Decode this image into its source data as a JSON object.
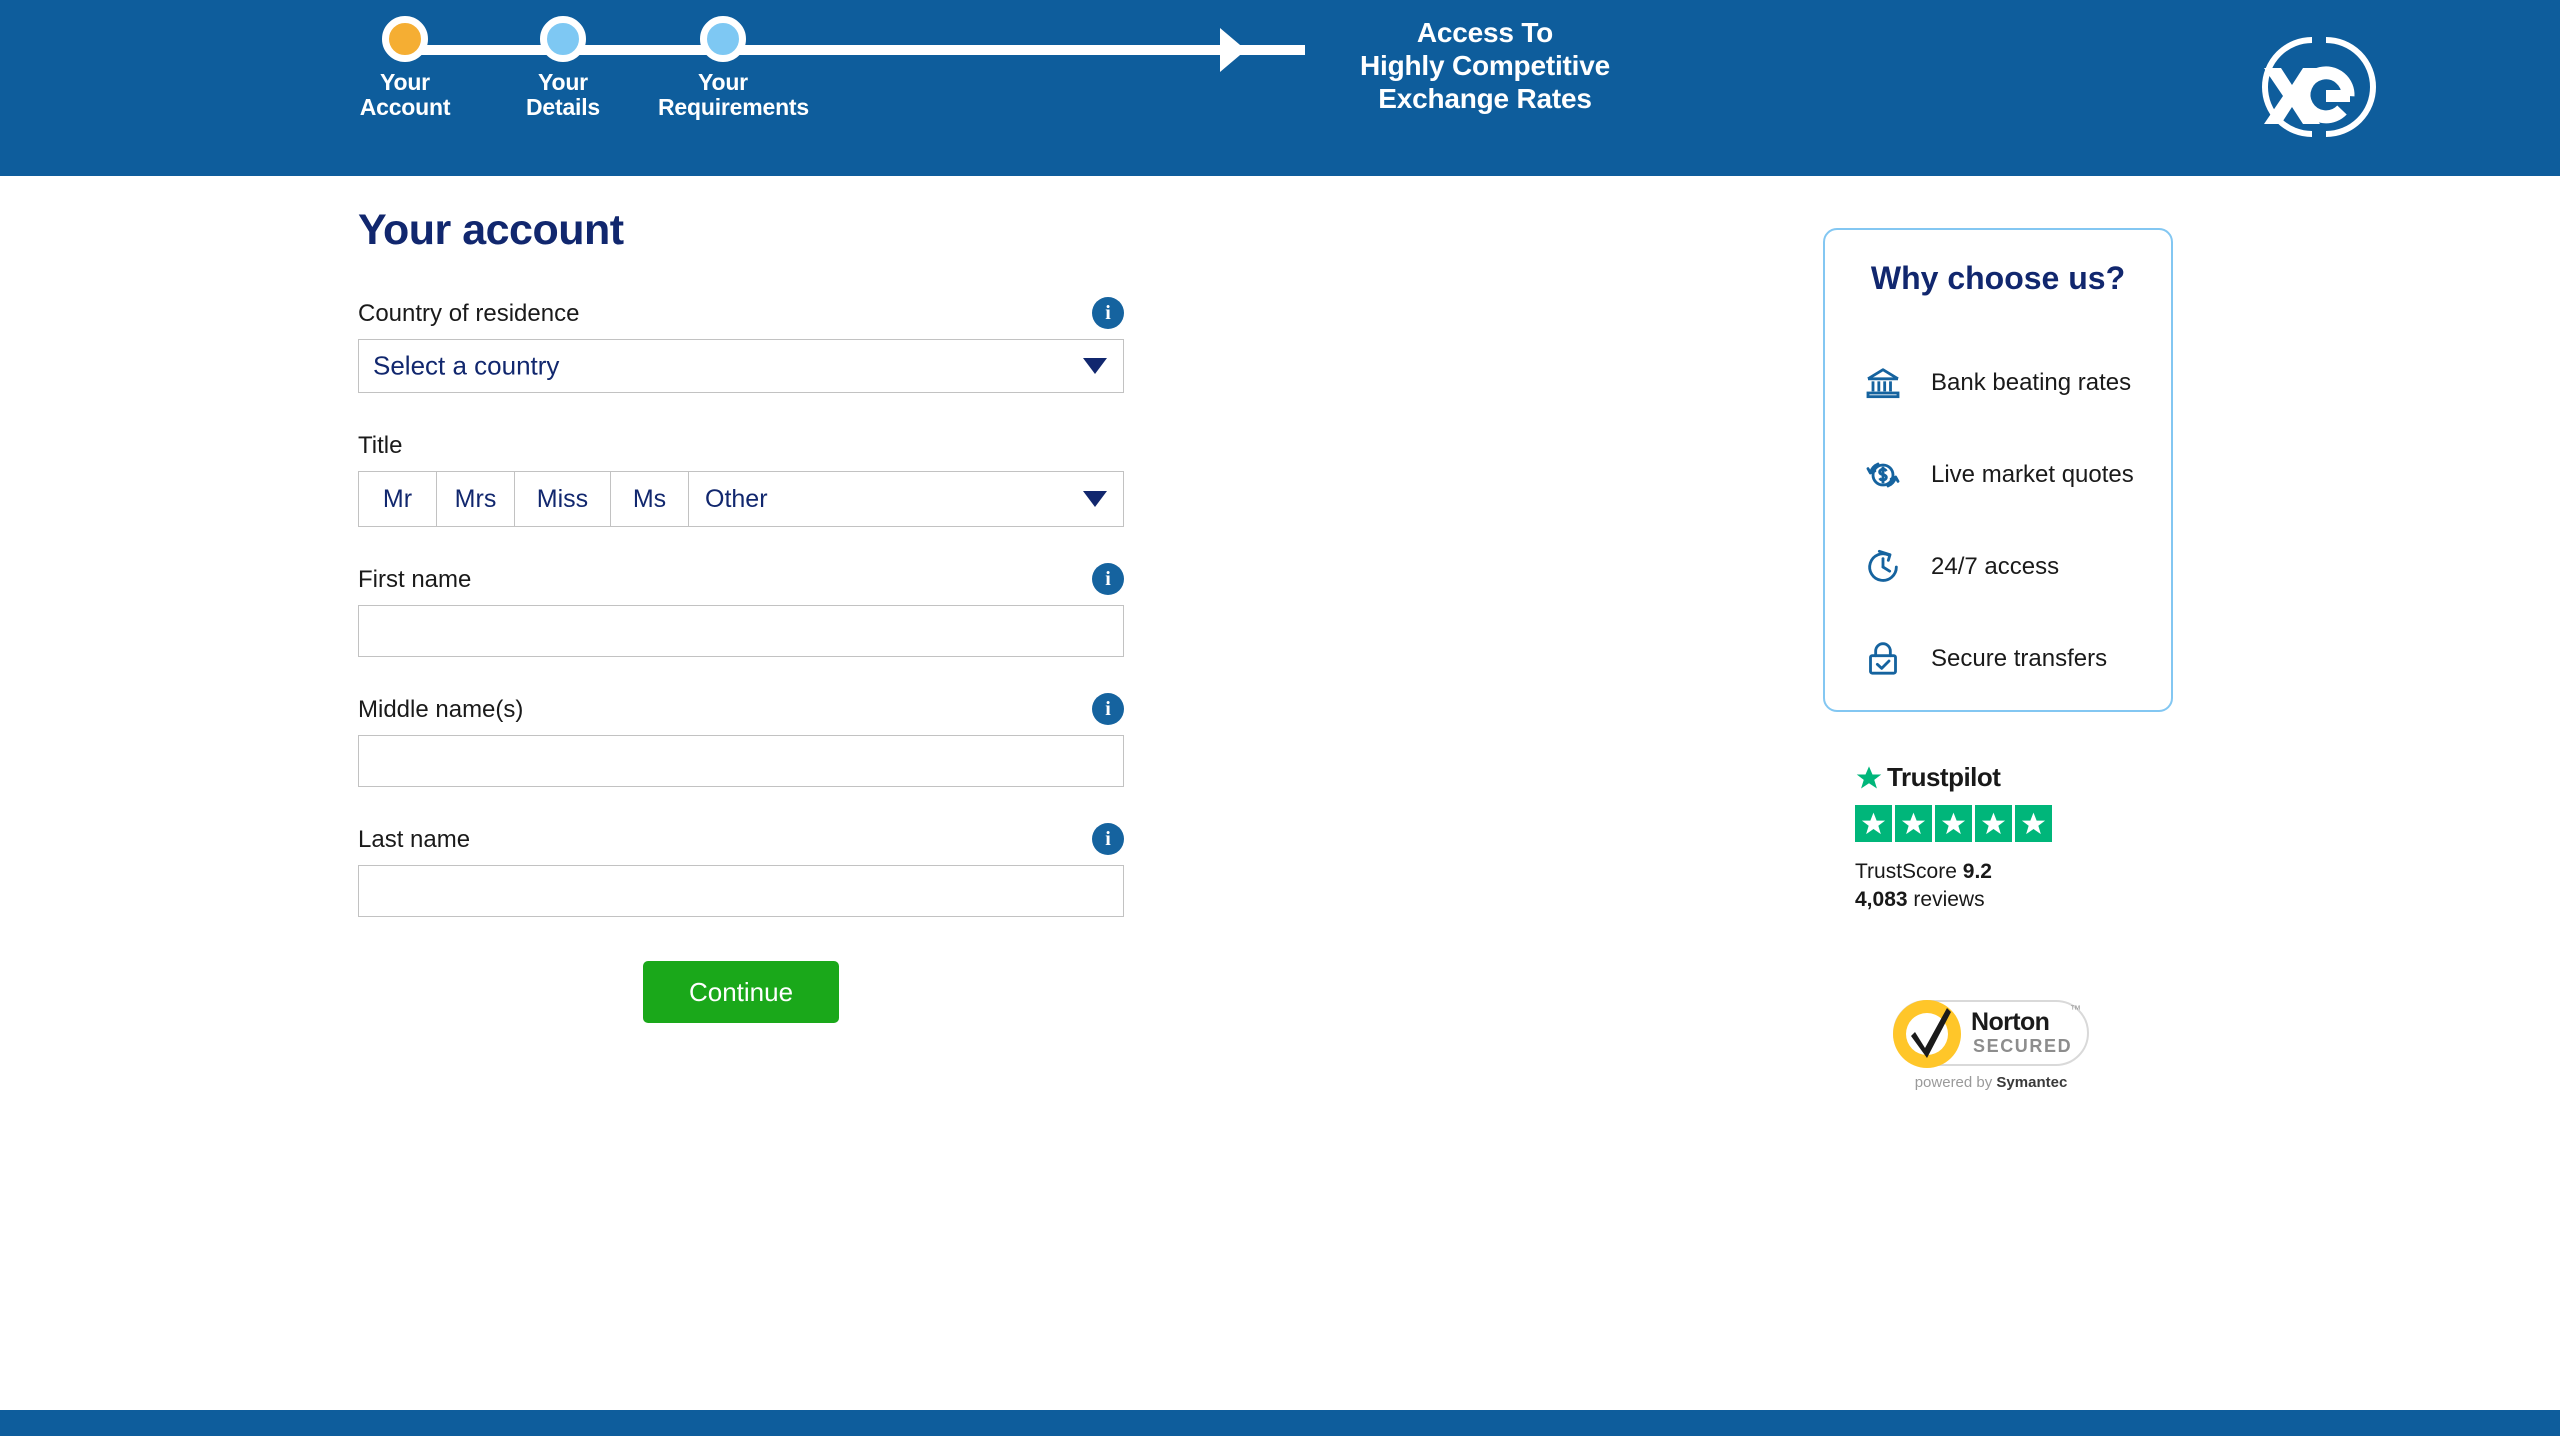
{
  "header": {
    "bg_color": "#0E5D9C",
    "steps": [
      {
        "label_line1": "Your",
        "label_line2": "Account",
        "state": "active",
        "dot_color": "#F5AE33"
      },
      {
        "label_line1": "Your",
        "label_line2": "Details",
        "state": "upcoming",
        "dot_color": "#7EC8F3"
      },
      {
        "label_line1": "Your",
        "label_line2": "Requirements",
        "state": "upcoming",
        "dot_color": "#7EC8F3"
      }
    ],
    "tagline_line1": "Access To",
    "tagline_line2": "Highly Competitive",
    "tagline_line3": "Exchange Rates",
    "logo_text": "xe"
  },
  "form": {
    "title": "Your account",
    "country": {
      "label": "Country of residence",
      "selected": "Select a country",
      "info": "i"
    },
    "title_field": {
      "label": "Title",
      "options": [
        "Mr",
        "Mrs",
        "Miss",
        "Ms"
      ],
      "other_label": "Other"
    },
    "first_name": {
      "label": "First name",
      "value": "",
      "info": "i"
    },
    "middle_name": {
      "label": "Middle name(s)",
      "value": "",
      "info": "i"
    },
    "last_name": {
      "label": "Last name",
      "value": "",
      "info": "i"
    },
    "submit_label": "Continue",
    "submit_color": "#1AA81A"
  },
  "sidebar": {
    "why_title": "Why choose us?",
    "border_color": "#83C7F2",
    "items": [
      {
        "icon": "bank-icon",
        "label": "Bank beating rates"
      },
      {
        "icon": "live-quotes-icon",
        "label": "Live market quotes"
      },
      {
        "icon": "clock-icon",
        "label": "24/7 access"
      },
      {
        "icon": "lock-check-icon",
        "label": "Secure transfers"
      }
    ],
    "trustpilot": {
      "brand": "Trustpilot",
      "star_color": "#00B67A",
      "stars": 5,
      "score_label": "TrustScore",
      "score_value": "9.2",
      "reviews_count": "4,083",
      "reviews_label": "reviews"
    },
    "norton": {
      "word": "Norton",
      "sub": "SECURED",
      "tm": "™",
      "powered_prefix": "powered by ",
      "powered_brand": "Symantec"
    }
  }
}
